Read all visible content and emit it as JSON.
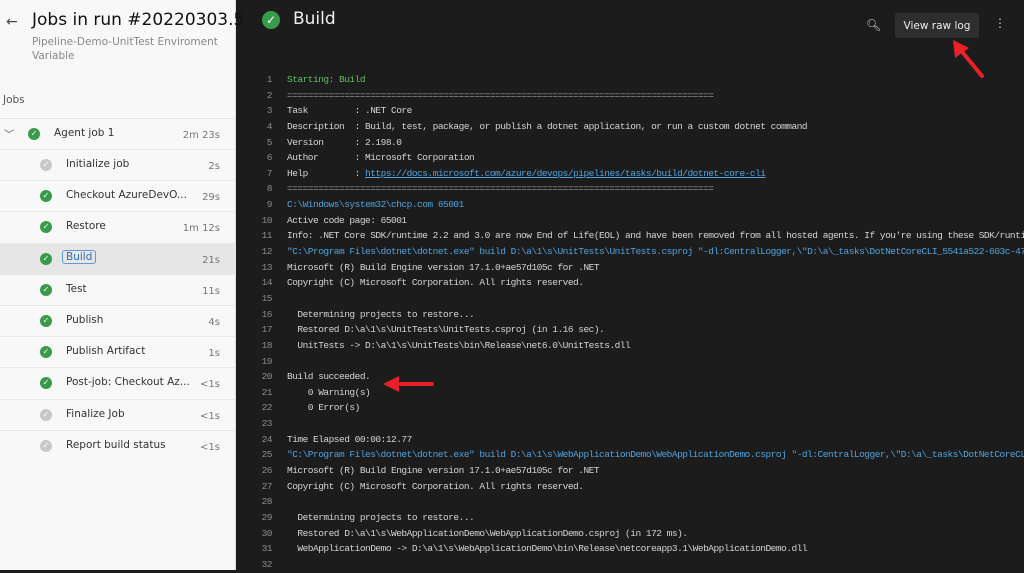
{
  "sidebar": {
    "back_icon": "arrow-left-icon",
    "title": "Jobs in run #20220303.5",
    "subtitle": "Pipeline-Demo-UnitTest Enviroment Variable",
    "jobs_heading": "Jobs",
    "agent_job": {
      "label": "Agent job 1",
      "duration": "2m 23s",
      "status": "succeeded"
    },
    "steps": [
      {
        "label": "Initialize job",
        "duration": "2s",
        "status": "neutral"
      },
      {
        "label": "Checkout AzureDevO...",
        "duration": "29s",
        "status": "succeeded"
      },
      {
        "label": "Restore",
        "duration": "1m 12s",
        "status": "succeeded"
      },
      {
        "label": "Build",
        "duration": "21s",
        "status": "succeeded",
        "selected": true
      },
      {
        "label": "Test",
        "duration": "11s",
        "status": "succeeded"
      },
      {
        "label": "Publish",
        "duration": "4s",
        "status": "succeeded"
      },
      {
        "label": "Publish Artifact",
        "duration": "1s",
        "status": "succeeded"
      },
      {
        "label": "Post-job: Checkout Az...",
        "duration": "<1s",
        "status": "succeeded"
      },
      {
        "label": "Finalize Job",
        "duration": "<1s",
        "status": "neutral"
      },
      {
        "label": "Report build status",
        "duration": "<1s",
        "status": "neutral"
      }
    ]
  },
  "main": {
    "title": "Build",
    "view_raw_log": "View raw log",
    "search_icon": "search-icon",
    "more_icon": "more-vertical-icon",
    "log": [
      {
        "t": "Starting: Build",
        "c": "green"
      },
      {
        "t": "==================================================================================",
        "c": "dim"
      },
      {
        "t": "Task         : .NET Core"
      },
      {
        "t": "Description  : Build, test, package, or publish a dotnet application, or run a custom dotnet command"
      },
      {
        "t": "Version      : 2.198.0"
      },
      {
        "t": "Author       : Microsoft Corporation"
      },
      {
        "t": "Help         : ",
        "link": "https://docs.microsoft.com/azure/devops/pipelines/tasks/build/dotnet-core-cli"
      },
      {
        "t": "==================================================================================",
        "c": "dim"
      },
      {
        "t": "C:\\Windows\\system32\\chcp.com 65001",
        "c": "blue"
      },
      {
        "t": "Active code page: 65001"
      },
      {
        "t": "Info: .NET Core SDK/runtime 2.2 and 3.0 are now End of Life(EOL) and have been removed from all hosted agents. If you're using these SDK/runti"
      },
      {
        "t": "\"C:\\Program Files\\dotnet\\dotnet.exe\" build D:\\a\\1\\s\\UnitTests\\UnitTests.csproj \"-dl:CentralLogger,\\\"D:\\a\\_tasks\\DotNetCoreCLI_5541a522-603c-47",
        "c": "blue"
      },
      {
        "t": "Microsoft (R) Build Engine version 17.1.0+ae57d105c for .NET"
      },
      {
        "t": "Copyright (C) Microsoft Corporation. All rights reserved."
      },
      {
        "t": ""
      },
      {
        "t": "  Determining projects to restore..."
      },
      {
        "t": "  Restored D:\\a\\1\\s\\UnitTests\\UnitTests.csproj (in 1.16 sec)."
      },
      {
        "t": "  UnitTests -> D:\\a\\1\\s\\UnitTests\\bin\\Release\\net6.0\\UnitTests.dll"
      },
      {
        "t": ""
      },
      {
        "t": "Build succeeded."
      },
      {
        "t": "    0 Warning(s)"
      },
      {
        "t": "    0 Error(s)"
      },
      {
        "t": ""
      },
      {
        "t": "Time Elapsed 00:00:12.77"
      },
      {
        "t": "\"C:\\Program Files\\dotnet\\dotnet.exe\" build D:\\a\\1\\s\\WebApplicationDemo\\WebApplicationDemo.csproj \"-dl:CentralLogger,\\\"D:\\a\\_tasks\\DotNetCoreCL",
        "c": "blue"
      },
      {
        "t": "Microsoft (R) Build Engine version 17.1.0+ae57d105c for .NET"
      },
      {
        "t": "Copyright (C) Microsoft Corporation. All rights reserved."
      },
      {
        "t": ""
      },
      {
        "t": "  Determining projects to restore..."
      },
      {
        "t": "  Restored D:\\a\\1\\s\\WebApplicationDemo\\WebApplicationDemo.csproj (in 172 ms)."
      },
      {
        "t": "  WebApplicationDemo -> D:\\a\\1\\s\\WebApplicationDemo\\bin\\Release\\netcoreapp3.1\\WebApplicationDemo.dll"
      },
      {
        "t": ""
      }
    ]
  },
  "colors": {
    "success": "#3a9a4c",
    "annotation_arrow": "#e8202a",
    "link": "#4fa3e0"
  }
}
